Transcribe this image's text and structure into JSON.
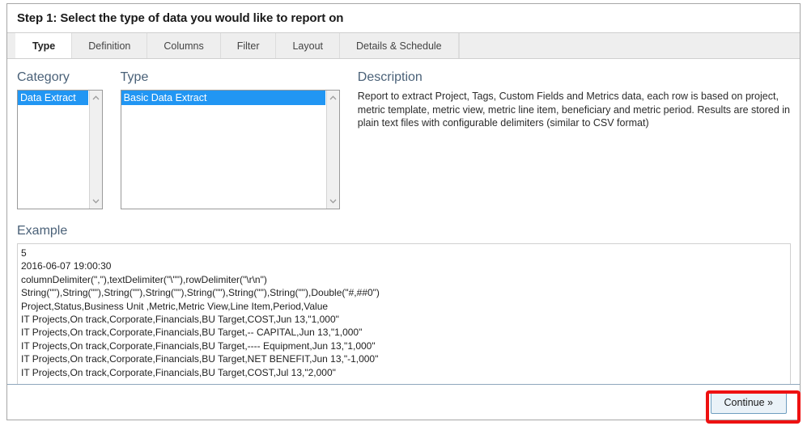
{
  "header": {
    "title": "Step 1: Select the type of data you would like to report on"
  },
  "tabs": [
    {
      "label": "Type",
      "active": true
    },
    {
      "label": "Definition",
      "active": false
    },
    {
      "label": "Columns",
      "active": false
    },
    {
      "label": "Filter",
      "active": false
    },
    {
      "label": "Layout",
      "active": false
    },
    {
      "label": "Details & Schedule",
      "active": false
    }
  ],
  "category": {
    "label": "Category",
    "options": [
      {
        "label": "Data Extract",
        "selected": true
      }
    ],
    "scroll_up_icon": "chevron-up-icon",
    "scroll_down_icon": "chevron-down-icon"
  },
  "type": {
    "label": "Type",
    "options": [
      {
        "label": "Basic Data Extract",
        "selected": true
      }
    ],
    "scroll_up_icon": "chevron-up-icon",
    "scroll_down_icon": "chevron-down-icon"
  },
  "description": {
    "label": "Description",
    "text": "Report to extract Project, Tags, Custom Fields and Metrics data, each row is based on project, metric template, metric view, metric line item, beneficiary and metric period. Results are stored in plain text files with configurable delimiters (similar to CSV format)"
  },
  "example": {
    "label": "Example",
    "lines": [
      "5",
      "2016-06-07 19:00:30",
      "columnDelimiter(\",\"),textDelimiter(\"\\\"\"),rowDelimiter(\"\\r\\n\")",
      "String(\"\"),String(\"\"),String(\"\"),String(\"\"),String(\"\"),String(\"\"),String(\"\"),Double(\"#,##0\")",
      "Project,Status,Business Unit ,Metric,Metric View,Line Item,Period,Value",
      "IT Projects,On track,Corporate,Financials,BU Target,COST,Jun 13,\"1,000\"",
      "IT Projects,On track,Corporate,Financials,BU Target,-- CAPITAL,Jun 13,\"1,000\"",
      "IT Projects,On track,Corporate,Financials,BU Target,---- Equipment,Jun 13,\"1,000\"",
      "IT Projects,On track,Corporate,Financials,BU Target,NET BENEFIT,Jun 13,\"-1,000\"",
      "IT Projects,On track,Corporate,Financials,BU Target,COST,Jul 13,\"2,000\""
    ]
  },
  "footer": {
    "continue_label": "Continue »"
  },
  "colors": {
    "selection_blue": "#2196f3",
    "highlight_red": "#ee1111",
    "section_heading": "#4a6178",
    "button_bg": "#eaf2f8",
    "button_border": "#6f9ec0",
    "tabstrip_bg": "#eeeeee"
  }
}
